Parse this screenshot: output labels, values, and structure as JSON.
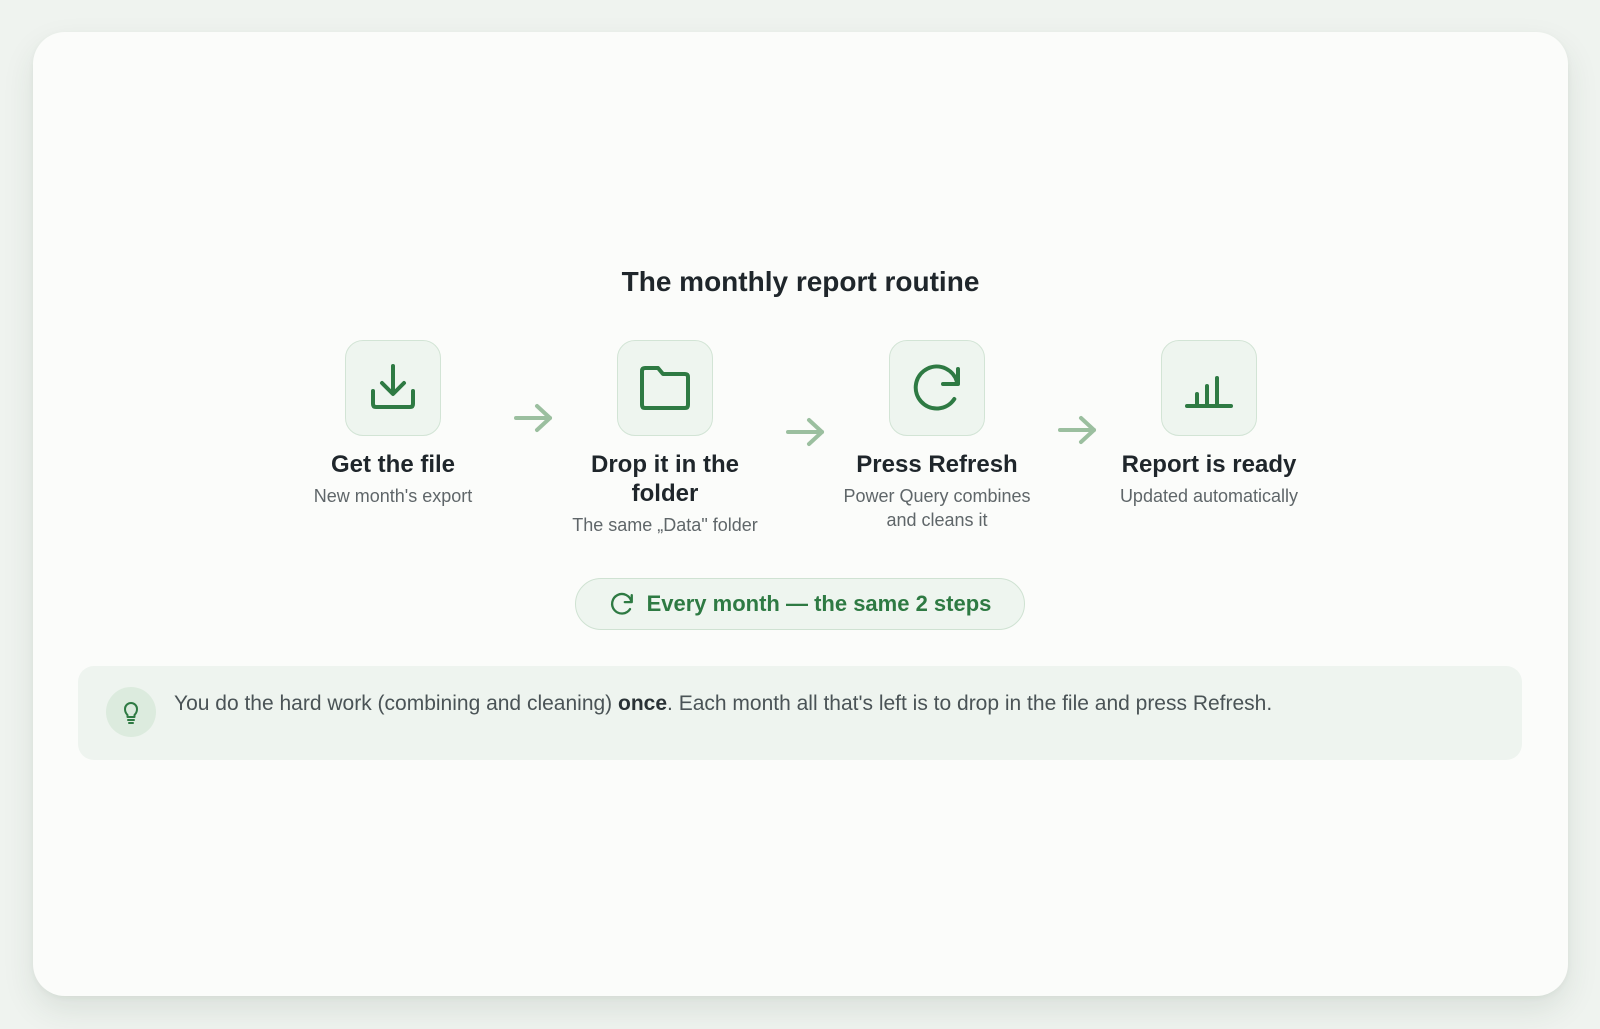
{
  "title": "The monthly report routine",
  "steps": [
    {
      "title": "Get the file",
      "subtitle": "New month's export",
      "icon": "download-icon"
    },
    {
      "title": "Drop it in the folder",
      "subtitle": "The same „Data\" folder",
      "icon": "folder-icon"
    },
    {
      "title": "Press Refresh",
      "subtitle": "Power Query combines and cleans it",
      "icon": "refresh-icon"
    },
    {
      "title": "Report is ready",
      "subtitle": "Updated automatically",
      "icon": "bar-chart-icon"
    }
  ],
  "banner": {
    "icon": "refresh-icon",
    "text": "Every month — the same 2 steps"
  },
  "tip": {
    "icon": "lightbulb-icon",
    "before": "You do the hard work (combining and cleaning) ",
    "emphasis": "once",
    "after": ". Each month all that's left is to drop in the file and press Refresh."
  },
  "colors": {
    "accent": "#2e7a43",
    "arrow": "#9bbf9f",
    "icon_bg": "#eef5ef",
    "text_dark": "#1f262b",
    "text_muted": "#5f6669"
  }
}
